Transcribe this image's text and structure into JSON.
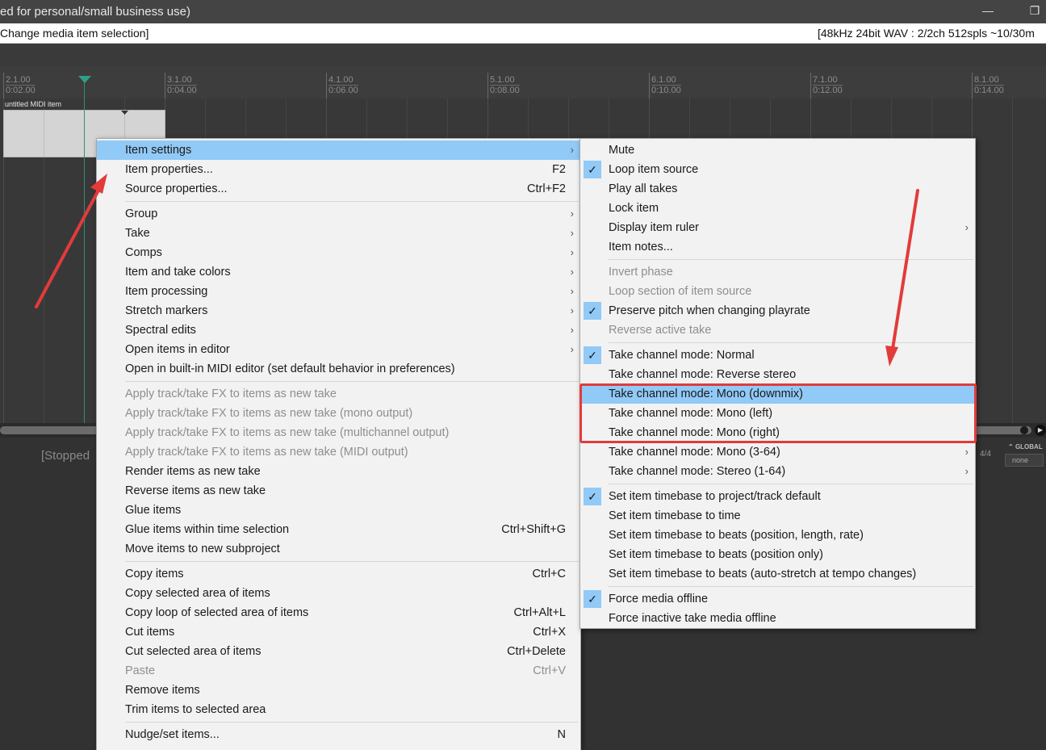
{
  "window": {
    "title": "ed for personal/small business use)",
    "restore_icon": "restore-window-icon",
    "minimize_icon": "minimize-icon"
  },
  "status": {
    "left": "Change media item selection]",
    "right": "[48kHz 24bit WAV : 2/2ch 512spls ~10/30m"
  },
  "ruler": {
    "markers": [
      {
        "bar": "2.1.00",
        "time": "0:02.00"
      },
      {
        "bar": "3.1.00",
        "time": "0:04.00"
      },
      {
        "bar": "4.1.00",
        "time": "0:06.00"
      },
      {
        "bar": "5.1.00",
        "time": "0:08.00"
      },
      {
        "bar": "6.1.00",
        "time": "0:10.00"
      },
      {
        "bar": "7.1.00",
        "time": "0:12.00"
      },
      {
        "bar": "8.1.00",
        "time": "0:14.00"
      }
    ]
  },
  "item": {
    "label": "untitled MIDI item"
  },
  "transport": {
    "status": "[Stopped",
    "time_signature": "4/4",
    "global_label": "GLOBAL",
    "none_label": "none"
  },
  "main_menu": {
    "items": [
      {
        "label": "Item settings",
        "submenu": true,
        "highlighted": true
      },
      {
        "label": "Item properties...",
        "shortcut": "F2"
      },
      {
        "label": "Source properties...",
        "shortcut": "Ctrl+F2"
      },
      {
        "label": "Group",
        "submenu": true
      },
      {
        "label": "Take",
        "submenu": true
      },
      {
        "label": "Comps",
        "submenu": true
      },
      {
        "label": "Item and take colors",
        "submenu": true
      },
      {
        "label": "Item processing",
        "submenu": true
      },
      {
        "label": "Stretch markers",
        "submenu": true
      },
      {
        "label": "Spectral edits",
        "submenu": true
      },
      {
        "label": "Open items in editor",
        "submenu": true
      },
      {
        "label": "Open in built-in MIDI editor (set default behavior in preferences)"
      },
      {
        "label": "Apply track/take FX to items as new take",
        "disabled": true
      },
      {
        "label": "Apply track/take FX to items as new take (mono output)",
        "disabled": true
      },
      {
        "label": "Apply track/take FX to items as new take (multichannel output)",
        "disabled": true
      },
      {
        "label": "Apply track/take FX to items as new take (MIDI output)",
        "disabled": true
      },
      {
        "label": "Render items as new take"
      },
      {
        "label": "Reverse items as new take"
      },
      {
        "label": "Glue items"
      },
      {
        "label": "Glue items within time selection",
        "shortcut": "Ctrl+Shift+G"
      },
      {
        "label": "Move items to new subproject"
      },
      {
        "label": "Copy items",
        "shortcut": "Ctrl+C"
      },
      {
        "label": "Copy selected area of items"
      },
      {
        "label": "Copy loop of selected area of items",
        "shortcut": "Ctrl+Alt+L"
      },
      {
        "label": "Cut items",
        "shortcut": "Ctrl+X"
      },
      {
        "label": "Cut selected area of items",
        "shortcut": "Ctrl+Delete"
      },
      {
        "label": "Paste",
        "shortcut": "Ctrl+V",
        "disabled": true
      },
      {
        "label": "Remove items"
      },
      {
        "label": "Trim items to selected area"
      },
      {
        "label": "Nudge/set items...",
        "shortcut": "N"
      }
    ]
  },
  "sub_menu": {
    "items": [
      {
        "label": "Mute"
      },
      {
        "label": "Loop item source",
        "checked": true
      },
      {
        "label": "Play all takes"
      },
      {
        "label": "Lock item"
      },
      {
        "label": "Display item ruler",
        "submenu": true
      },
      {
        "label": "Item notes..."
      },
      {
        "label": "Invert phase",
        "disabled": true
      },
      {
        "label": "Loop section of item source",
        "disabled": true
      },
      {
        "label": "Preserve pitch when changing playrate",
        "checked": true
      },
      {
        "label": "Reverse active take",
        "disabled": true
      },
      {
        "label": "Take channel mode: Normal",
        "checked": true
      },
      {
        "label": "Take channel mode: Reverse stereo"
      },
      {
        "label": "Take channel mode: Mono (downmix)",
        "highlighted": true
      },
      {
        "label": "Take channel mode: Mono (left)"
      },
      {
        "label": "Take channel mode: Mono (right)"
      },
      {
        "label": "Take channel mode: Mono (3-64)",
        "submenu": true
      },
      {
        "label": "Take channel mode: Stereo (1-64)",
        "submenu": true
      },
      {
        "label": "Set item timebase to project/track default",
        "checked": true
      },
      {
        "label": "Set item timebase to time"
      },
      {
        "label": "Set item timebase to beats (position, length, rate)"
      },
      {
        "label": "Set item timebase to beats (position only)"
      },
      {
        "label": "Set item timebase to beats (auto-stretch at tempo changes)"
      },
      {
        "label": "Force media offline",
        "checked": true
      },
      {
        "label": "Force inactive take media offline"
      }
    ]
  },
  "colors": {
    "highlight": "#91c9f7",
    "annotation_red": "#e23b3b",
    "menu_bg": "#f2f2f2"
  }
}
